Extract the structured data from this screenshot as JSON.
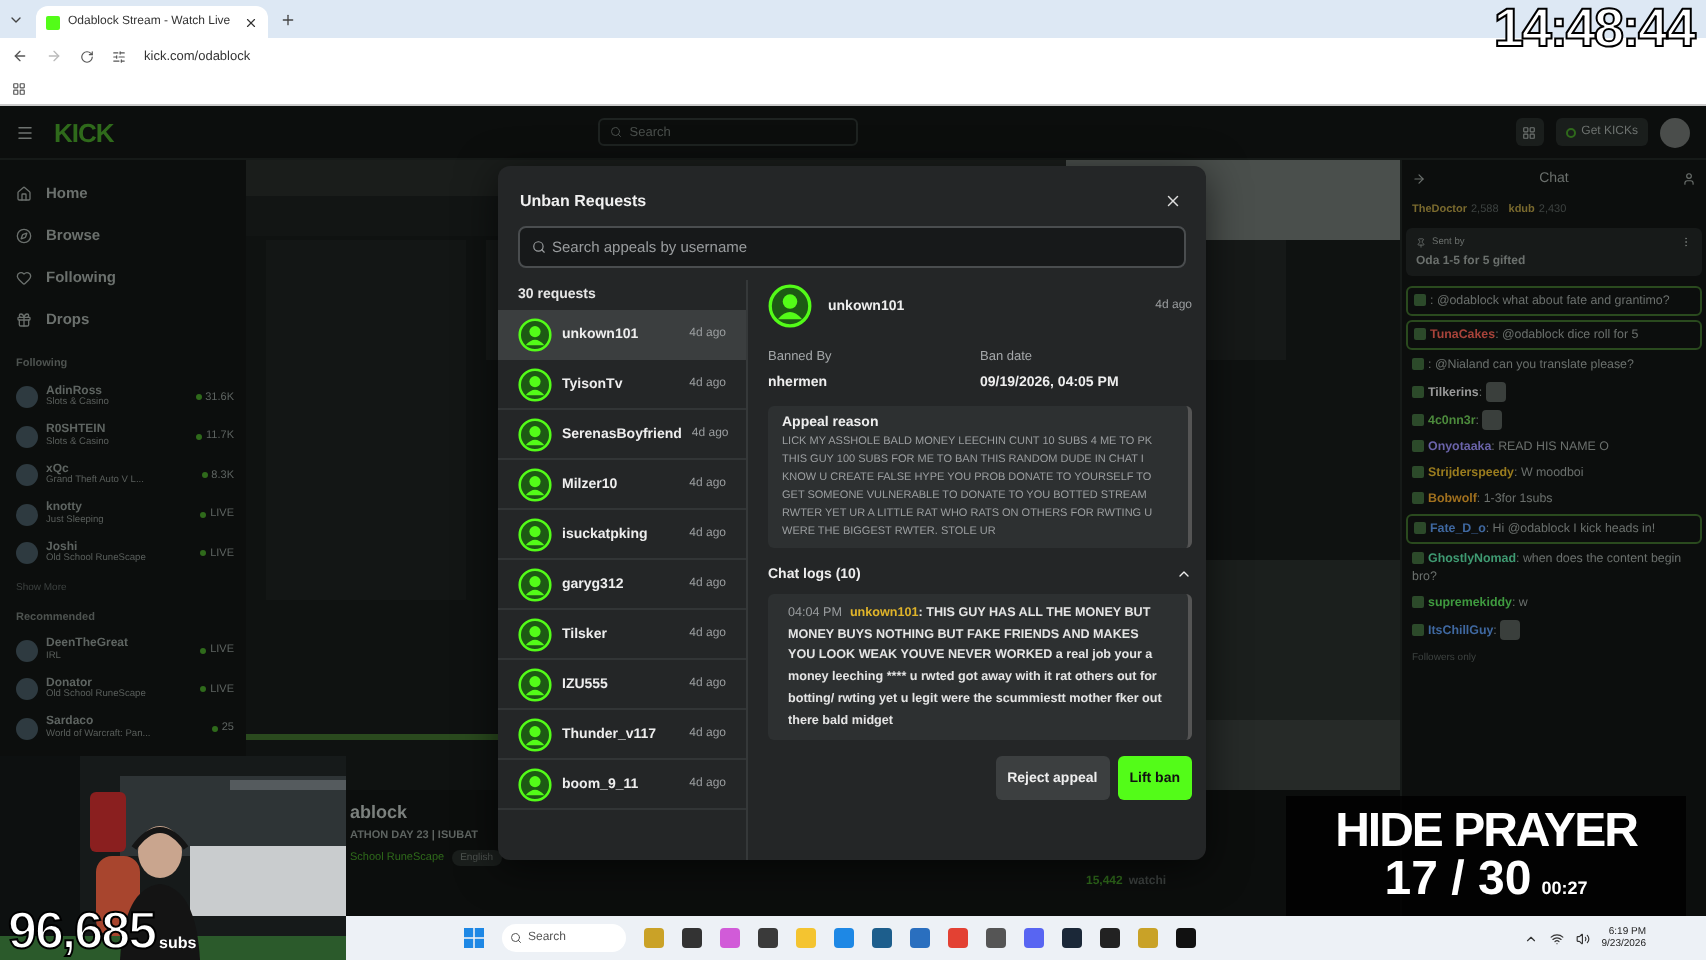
{
  "browser": {
    "tab_title": "Odablock Stream - Watch Live",
    "url": "kick.com/odablock"
  },
  "overlay_clock": "14:48:44",
  "kick_header": {
    "logo": "KICK",
    "search_placeholder": "Search",
    "get_kicks": "Get KICKs"
  },
  "sidebar": {
    "nav": [
      {
        "label": "Home"
      },
      {
        "label": "Browse"
      },
      {
        "label": "Following"
      },
      {
        "label": "Drops"
      }
    ],
    "following_title": "Following",
    "following": [
      {
        "name": "AdinRoss",
        "category": "Slots & Casino",
        "viewers": "31.6K"
      },
      {
        "name": "R0SHTEIN",
        "category": "Slots & Casino",
        "viewers": "11.7K"
      },
      {
        "name": "xQc",
        "category": "Grand Theft Auto V L...",
        "viewers": "8.3K"
      },
      {
        "name": "knotty",
        "category": "Just Sleeping",
        "viewers": "LIVE"
      },
      {
        "name": "Joshi",
        "category": "Old School RuneScape",
        "viewers": "LIVE"
      }
    ],
    "show_more": "Show More",
    "recommended_title": "Recommended",
    "recommended": [
      {
        "name": "DeenTheGreat",
        "category": "IRL",
        "viewers": "LIVE"
      },
      {
        "name": "Donator",
        "category": "Old School RuneScape",
        "viewers": "LIVE"
      },
      {
        "name": "Sardaco",
        "category": "World of Warcraft: Pan...",
        "viewers": "25"
      }
    ]
  },
  "stream": {
    "channel": "ablock",
    "title": "ATHON DAY 23 | ISUBAT",
    "category": "School RuneScape",
    "tag": "English",
    "viewers": "15,442",
    "viewers_label": "watchi"
  },
  "chat": {
    "title": "Chat",
    "top_gifters": [
      {
        "name": "TheDoctor",
        "count": "2,588"
      },
      {
        "name": "kdub",
        "count": "2,430"
      }
    ],
    "pinned": {
      "label": "Sent by",
      "message": "Oda 1-5 for 5 gifted"
    },
    "messages": [
      {
        "text": ": @odablock what about fate and grantimo?",
        "highlighted": true
      },
      {
        "user": "TunaCakes",
        "color": "#a8433a",
        "text": ": @odablock dice roll for 5",
        "highlighted": true
      },
      {
        "text": ": @Nialand can you translate please?",
        "highlighted": false
      },
      {
        "user": "Tilkerins",
        "color": "#9a9a9a",
        "text": ":",
        "emote": true,
        "highlighted": false
      },
      {
        "user": "4c0nn3r",
        "color": "#4c8a3c",
        "text": ":",
        "emote": true,
        "highlighted": false
      },
      {
        "user": "Onyotaaka",
        "color": "#6a63a8",
        "text": ": READ HIS NAME O",
        "highlighted": false
      },
      {
        "user": "Strijderspeedy",
        "color": "#9a7c1e",
        "text": ": W moodboi",
        "highlighted": false
      },
      {
        "user": "Bobwolf",
        "color": "#a0701e",
        "text": ": 1-3for 1subs",
        "highlighted": false
      },
      {
        "user": "Fate_D_o",
        "color": "#3f68a0",
        "text": ": Hi @odablock I kick heads in!",
        "highlighted": true
      },
      {
        "user": "GhostlyNomad",
        "color": "#3f9a72",
        "text": ": when does the content begin bro?",
        "highlighted": false
      },
      {
        "user": "supremekiddy",
        "color": "#3f9a3f",
        "text": ": w",
        "highlighted": false
      },
      {
        "user": "ItsChillGuy",
        "color": "#3f68a0",
        "text": ":",
        "emote": true,
        "highlighted": false
      }
    ],
    "mode": "Followers only"
  },
  "unban_modal": {
    "title": "Unban Requests",
    "search_placeholder": "Search appeals by username",
    "count": "30 requests",
    "requests": [
      {
        "username": "unkown101",
        "time": "4d ago",
        "selected": true
      },
      {
        "username": "TyisonTv",
        "time": "4d ago",
        "selected": false
      },
      {
        "username": "SerenasBoyfriend",
        "time": "4d ago",
        "selected": false
      },
      {
        "username": "Milzer10",
        "time": "4d ago",
        "selected": false
      },
      {
        "username": "isuckatpking",
        "time": "4d ago",
        "selected": false
      },
      {
        "username": "garyg312",
        "time": "4d ago",
        "selected": false
      },
      {
        "username": "Tilsker",
        "time": "4d ago",
        "selected": false
      },
      {
        "username": "IZU555",
        "time": "4d ago",
        "selected": false
      },
      {
        "username": "Thunder_v117",
        "time": "4d ago",
        "selected": false
      },
      {
        "username": "boom_9_11",
        "time": "4d ago",
        "selected": false
      }
    ],
    "detail": {
      "username": "unkown101",
      "time": "4d ago",
      "banned_by_label": "Banned By",
      "banned_by": "nhermen",
      "ban_date_label": "Ban date",
      "ban_date": "09/19/2026, 04:05 PM",
      "appeal_title": "Appeal reason",
      "appeal_text": "LICK MY ASSHOLE BALD MONEY LEECHIN CUNT 10 SUBS 4 ME TO PK THIS GUY 100 SUBS FOR ME TO BAN THIS RANDOM DUDE IN CHAT I KNOW U CREATE FALSE HYPE YOU PROB DONATE TO YOURSELF TO GET SOMEONE VULNERABLE TO DONATE TO YOU BOTTED STREAM RWTER YET UR A LITTLE RAT WHO RATS ON OTHERS FOR RWTING U WERE THE BIGGEST RWTER. STOLE UR",
      "chat_logs_title": "Chat logs (10)",
      "chat_logs_expanded": true,
      "chat_logs": [
        {
          "time": "04:04 PM",
          "user": "unkown101",
          "text": ": THIS GUY HAS ALL THE MONEY BUT MONEY BUYS NOTHING BUT FAKE FRIENDS AND MAKES YOU LOOK WEAK YOUVE NEVER WORKED a real job your a money leeching **** u rwted got away with it rat others out for botting/ rwting yet u legit were the scummiestt mother fker out there bald midget"
        }
      ]
    },
    "buttons": [
      {
        "label": "Reject appeal",
        "kind": "secondary"
      },
      {
        "label": "Lift ban",
        "kind": "primary"
      }
    ]
  },
  "webcam_overlay": {
    "subs_count": "96,685",
    "subs_label": "subs"
  },
  "prayer_overlay": {
    "title": "HIDE PRAYER",
    "progress": "17 / 30",
    "timer": "00:27"
  },
  "taskbar": {
    "search_placeholder": "Search",
    "time": "6:19 PM",
    "date": "9/23/2026"
  }
}
